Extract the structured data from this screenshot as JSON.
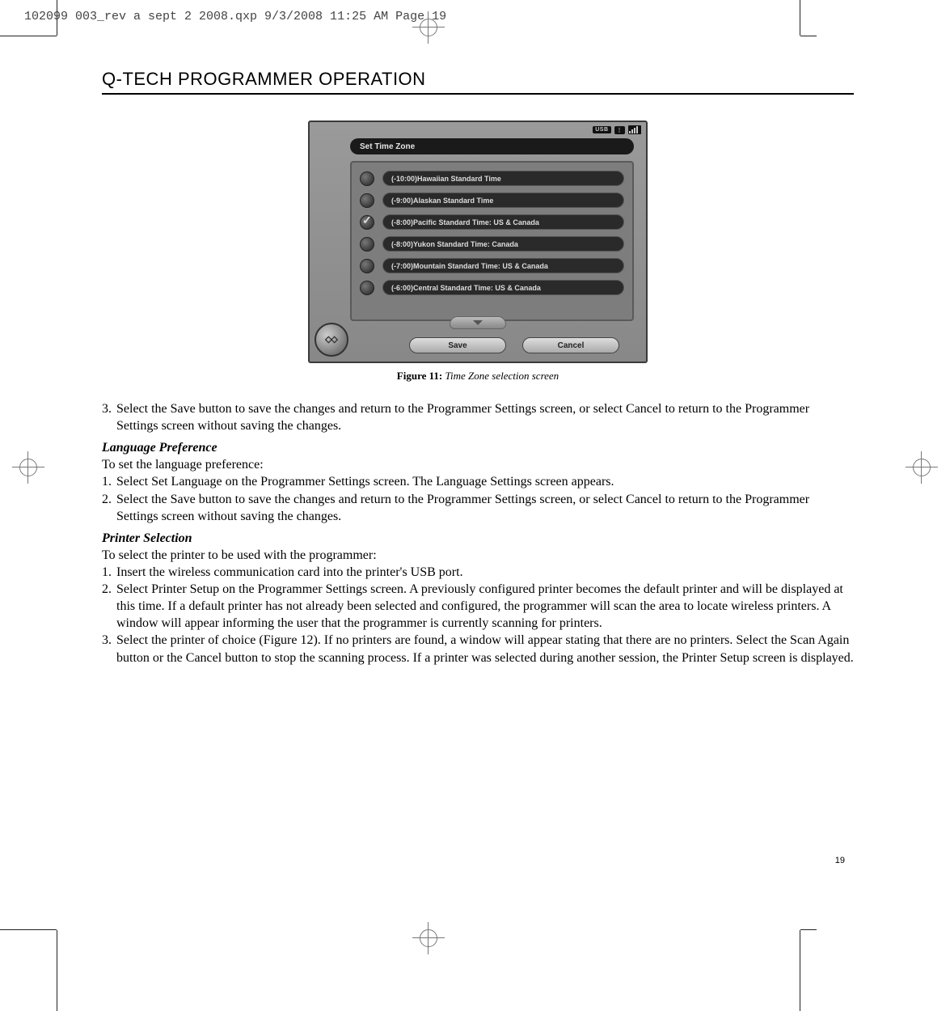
{
  "print_header": "102099 003_rev a sept 2 2008.qxp  9/3/2008  11:25 AM  Page 19",
  "section_title": "Q-TECH PROGRAMMER OPERATION",
  "figure": {
    "status_label": "USB",
    "panel_title": "Set Time Zone",
    "options": [
      {
        "label": "(-10:00)Hawaiian Standard Time",
        "selected": false
      },
      {
        "label": "(-9:00)Alaskan Standard Time",
        "selected": false
      },
      {
        "label": "(-8:00)Pacific Standard Time: US & Canada",
        "selected": true
      },
      {
        "label": "(-8:00)Yukon Standard Time: Canada",
        "selected": false
      },
      {
        "label": "(-7:00)Mountain Standard Time: US & Canada",
        "selected": false
      },
      {
        "label": "(-6:00)Central Standard Time: US & Canada",
        "selected": false
      }
    ],
    "save_label": "Save",
    "cancel_label": "Cancel",
    "caption_label": "Figure 11:",
    "caption_text": "Time Zone selection screen"
  },
  "step3": {
    "num": "3.",
    "text": "Select the Save button to save the changes and return to the Programmer Settings screen, or select Cancel to return to the Programmer Settings screen without saving the changes."
  },
  "lang": {
    "heading": "Language Preference",
    "intro": "To set the language preference:",
    "items": [
      {
        "num": "1.",
        "text": "Select Set Language on the Programmer Settings screen. The Language Settings screen appears."
      },
      {
        "num": "2.",
        "text": "Select the Save button to save the changes and return to the Programmer Settings screen, or select Cancel to return to the Programmer Settings screen without saving the changes."
      }
    ]
  },
  "printer": {
    "heading": "Printer Selection",
    "intro": "To select the printer to be used with the programmer:",
    "items": [
      {
        "num": "1.",
        "text": "Insert the wireless communication card into the printer's USB port."
      },
      {
        "num": "2.",
        "text": "Select Printer Setup on the Programmer Settings screen. A previously configured printer becomes the default printer and will be displayed at this time. If a default printer has not already been selected and configured, the programmer will scan the area to locate wireless printers. A window will appear informing the user that the programmer is currently scanning for printers."
      },
      {
        "num": "3.",
        "text": "Select the printer of choice (Figure 12). If no printers are found, a window will appear stating that there are no printers. Select the Scan Again button or the Cancel button to stop the scanning process. If a printer was selected during another session, the Printer Setup screen is displayed."
      }
    ]
  },
  "page_number": "19"
}
